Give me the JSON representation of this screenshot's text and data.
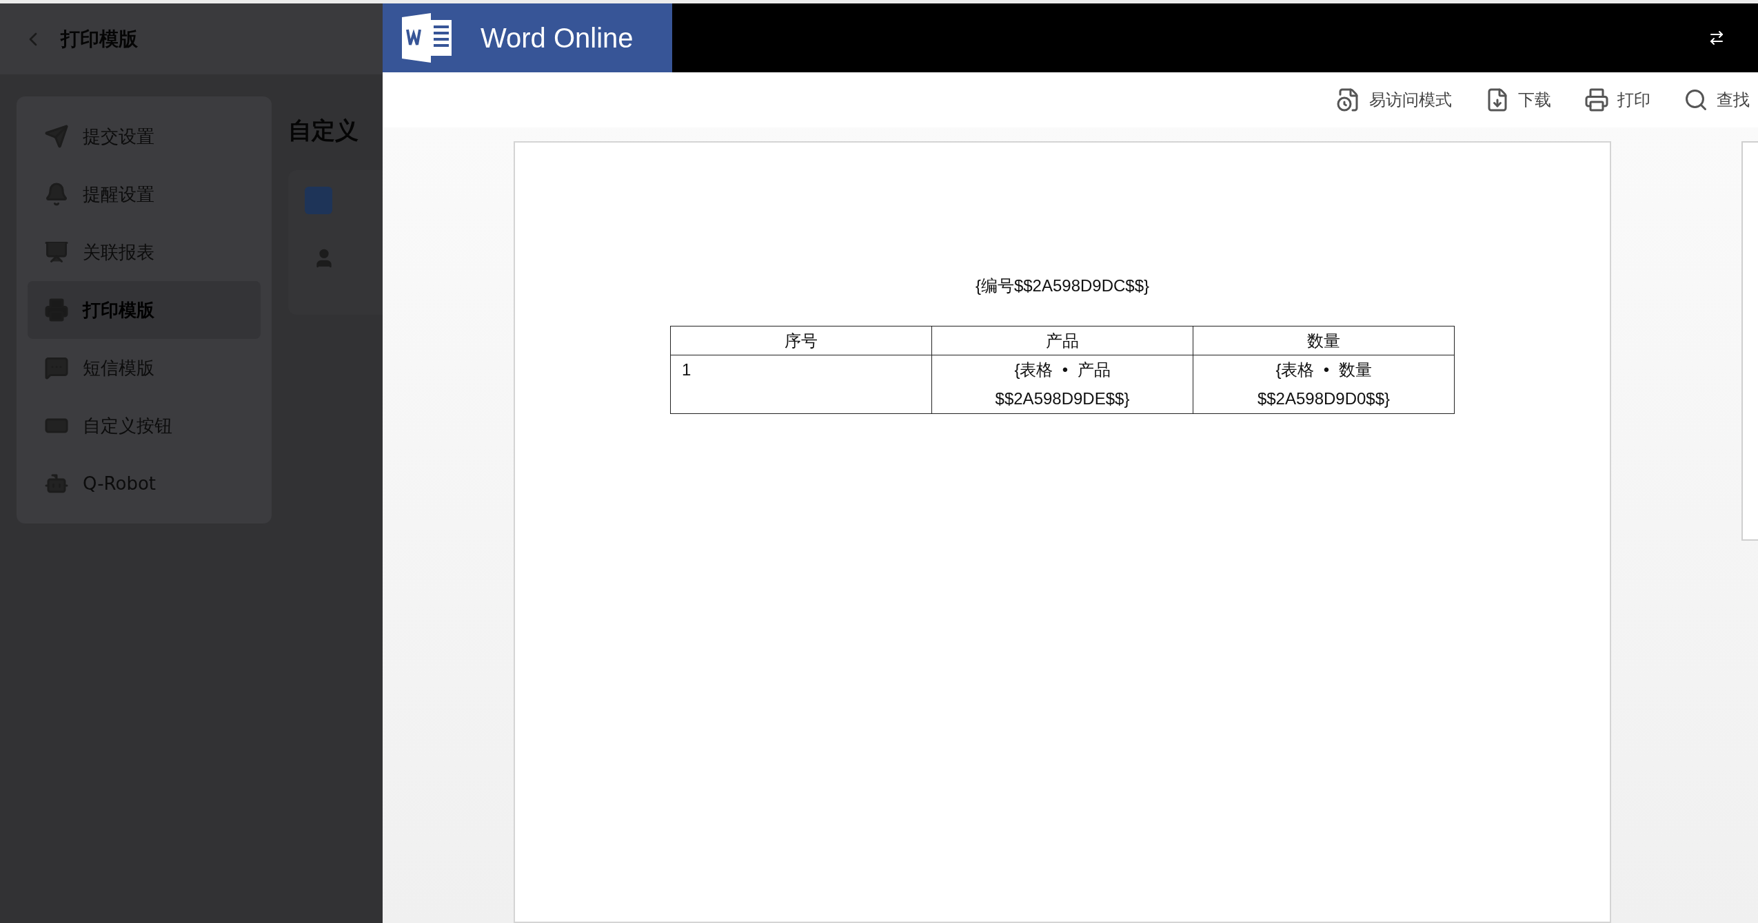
{
  "left_panel": {
    "header": {
      "title": "打印模版"
    },
    "sidebar": {
      "items": [
        {
          "label": "提交设置",
          "kind": "send",
          "selected": false
        },
        {
          "label": "提醒设置",
          "kind": "bell",
          "selected": false
        },
        {
          "label": "关联报表",
          "kind": "board",
          "selected": false
        },
        {
          "label": "打印模版",
          "kind": "printer",
          "selected": true
        },
        {
          "label": "短信模版",
          "kind": "chat",
          "selected": false
        },
        {
          "label": "自定义按钮",
          "kind": "btn",
          "selected": false
        },
        {
          "label": "Q-Robot",
          "kind": "robot",
          "selected": false
        }
      ]
    },
    "content": {
      "heading": "自定义"
    }
  },
  "word": {
    "app_title": "Word Online",
    "toolbar": [
      {
        "label": "易访问模式",
        "kind": "accessibility"
      },
      {
        "label": "下载",
        "kind": "download"
      },
      {
        "label": "打印",
        "kind": "print"
      },
      {
        "label": "查找",
        "kind": "search"
      }
    ],
    "document": {
      "title": "{编号$$2A598D9DC$$}",
      "table": {
        "columns": [
          "序号",
          "产品",
          "数量"
        ],
        "rows": [
          [
            "1",
            "{表格  •  产品 $$2A598D9DE$$}",
            "{表格  •  数量 $$2A598D9D0$$}"
          ]
        ]
      }
    }
  }
}
